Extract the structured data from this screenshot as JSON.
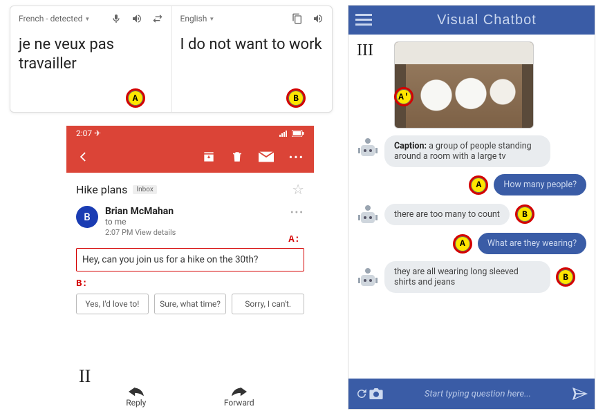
{
  "translate": {
    "source_lang": "French - detected",
    "target_lang": "English",
    "source_text": "je ne veux pas travailler",
    "target_text": "I do not want to work",
    "badge_source": "A",
    "badge_target": "B"
  },
  "email": {
    "status_time": "2:07 ✈",
    "subject": "Hike plans",
    "tag": "Inbox",
    "sender_name": "Brian McMahan",
    "sender_to": "to me",
    "time_line": "2:07 PM  View details",
    "sender_initial": "B",
    "label_a": "A:",
    "message": "Hey, can you join us for a hike on the 30th?",
    "label_b": "B:",
    "replies": [
      "Yes, I'd love to!",
      "Sure, what time?",
      "Sorry, I can't."
    ],
    "footer_reply": "Reply",
    "footer_forward": "Forward",
    "roman": "II"
  },
  "chatbot": {
    "title": "Visual Chatbot",
    "roman": "III",
    "badge_image": "A'",
    "caption_label": "Caption:",
    "caption_text": "a group of people standing around a room with a large tv",
    "q1": "How many people?",
    "a1": "there are too many to count",
    "q2": "What are they wearing?",
    "a2": "they are all wearing long sleeved shirts and jeans",
    "badge_a": "A",
    "badge_b": "B",
    "input_placeholder": "Start typing question here..."
  }
}
